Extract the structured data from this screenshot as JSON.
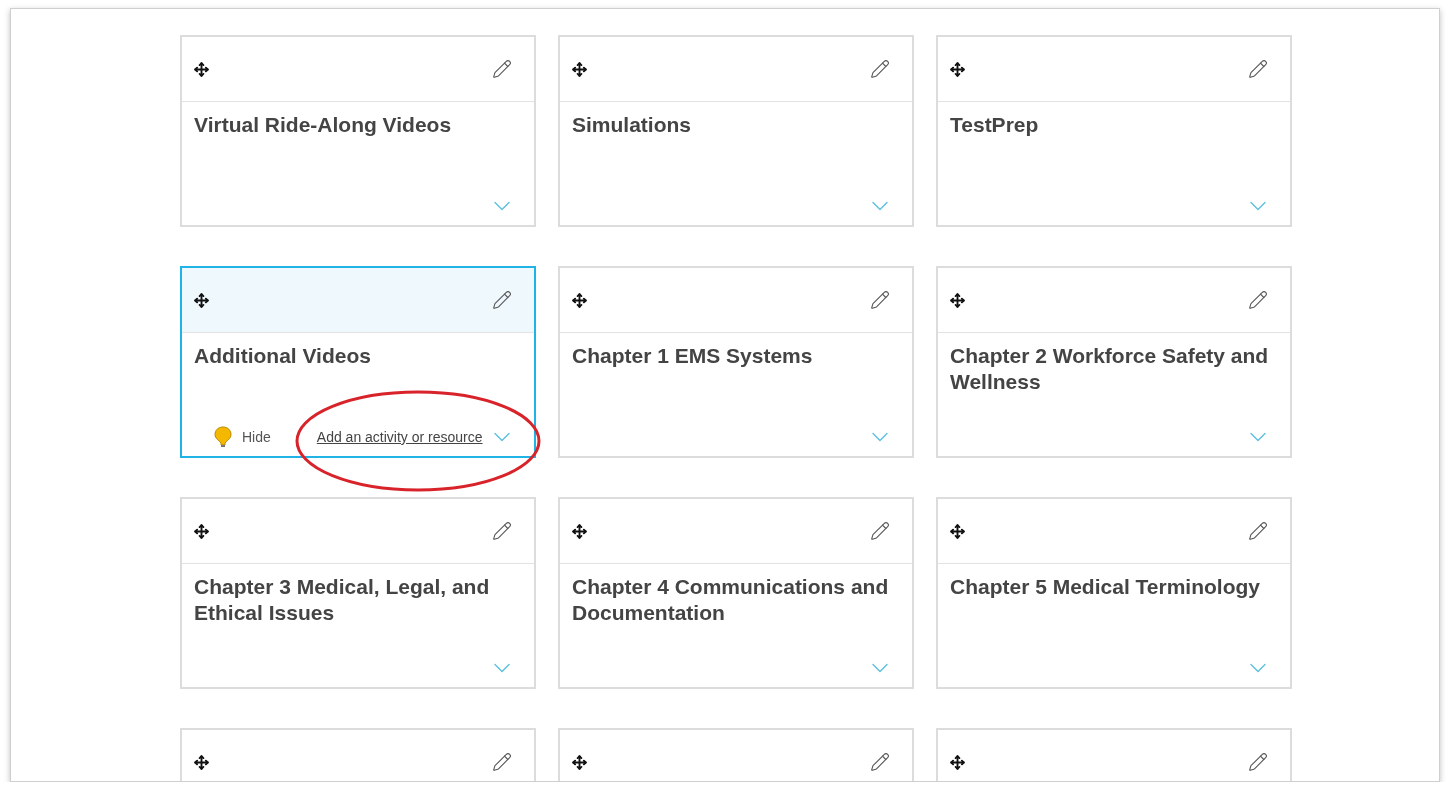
{
  "cards": [
    {
      "title": "Virtual Ride-Along Videos",
      "selected": false
    },
    {
      "title": "Simulations",
      "selected": false
    },
    {
      "title": "TestPrep",
      "selected": false
    },
    {
      "title": "Additional Videos",
      "selected": true,
      "circled": true,
      "actions": {
        "hide_label": "Hide",
        "add_link": "Add an activity or resource"
      }
    },
    {
      "title": "Chapter 1 EMS Systems",
      "selected": false
    },
    {
      "title": "Chapter 2 Workforce Safety and Wellness",
      "selected": false
    },
    {
      "title": "Chapter 3 Medical, Legal, and Ethical Issues",
      "selected": false
    },
    {
      "title": "Chapter 4 Communications and Documentation",
      "selected": false
    },
    {
      "title": "Chapter 5 Medical Terminology",
      "selected": false
    },
    {
      "selected": false
    },
    {
      "selected": false
    },
    {
      "selected": false
    }
  ]
}
